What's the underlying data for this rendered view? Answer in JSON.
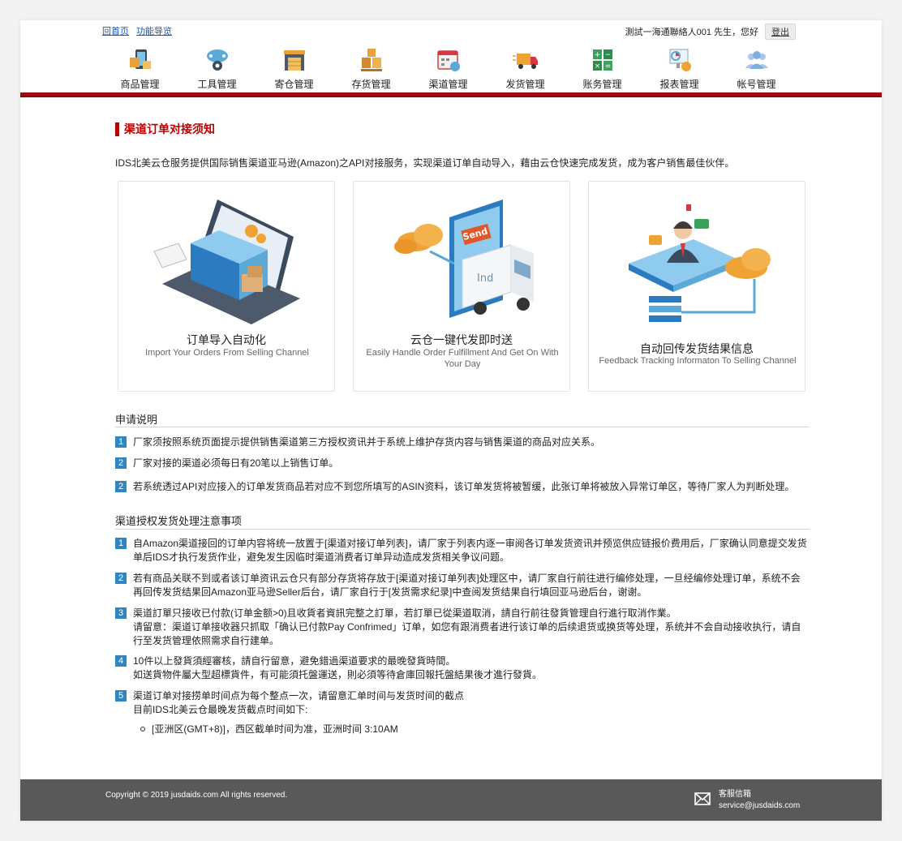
{
  "header": {
    "links": [
      "回首页",
      "功能导览"
    ],
    "greeting": "測試一海通聯絡人001 先生，您好",
    "logout": "登出"
  },
  "nav": [
    {
      "label": "商品管理",
      "icon": "product-icon"
    },
    {
      "label": "工具管理",
      "icon": "tools-icon"
    },
    {
      "label": "寄仓管理",
      "icon": "warehouse-icon"
    },
    {
      "label": "存货管理",
      "icon": "inventory-icon"
    },
    {
      "label": "渠道管理",
      "icon": "channel-icon"
    },
    {
      "label": "发货管理",
      "icon": "shipping-icon"
    },
    {
      "label": "账务管理",
      "icon": "accounting-icon"
    },
    {
      "label": "报表管理",
      "icon": "report-icon"
    },
    {
      "label": "帐号管理",
      "icon": "account-icon"
    }
  ],
  "page": {
    "title": "渠道订单对接须知",
    "intro": "IDS北美云仓服务提供国际销售渠道亚马逊(Amazon)之API对接服务，实现渠道订单自动导入，藉由云仓快速完成发货，成为客户销售最佳伙伴。"
  },
  "cards": [
    {
      "title": "订单导入自动化",
      "subtitle": "Import Your Orders From Selling Channel"
    },
    {
      "title": "云仓一键代发即时送",
      "subtitle": "Easily Handle Order Fulfillment And Get On With Your Day",
      "badge_text": "Send",
      "truck_text": "Ind"
    },
    {
      "title": "自动回传发货结果信息",
      "subtitle": "Feedback Tracking Informaton To Selling Channel"
    }
  ],
  "application": {
    "heading": "申请说明",
    "items": [
      {
        "num": "1",
        "text": "厂家须按照系统页面提示提供销售渠道第三方授权资讯并于系统上维护存货内容与销售渠道的商品对应关系。"
      },
      {
        "num": "2",
        "text": "厂家对接的渠道必须每日有20笔以上销售订单。"
      },
      {
        "num": "2",
        "text": "若系统透过API对应接入的订单发货商品若对应不到您所填写的ASIN资料，该订单发货将被暂缓，此张订单将被放入异常订单区，等待厂家人为判断处理。"
      }
    ]
  },
  "notes": {
    "heading": "渠道授权发货处理注意事项",
    "items": [
      {
        "num": "1",
        "text": "自Amazon渠道接回的订单内容将统一放置于[渠道对接订单列表]，请厂家于列表内逐一审阅各订单发货资讯并预览供应链报价费用后，厂家确认同意提交发货单后IDS才执行发货作业，避免发生因临时渠道消费者订单异动造成发货相关争议问题。"
      },
      {
        "num": "2",
        "text": "若有商品关联不到或者该订单资讯云仓只有部分存货将存放于[渠道对接订单列表]处理区中，请厂家自行前往进行编修处理，一旦经编修处理订单，系统不会再回传发货结果回Amazon亚马逊Seller后台，请厂家自行于[发货需求纪录]中查阅发货结果自行填回亚马逊后台，谢谢。"
      },
      {
        "num": "3",
        "text": "渠道訂單只接收已付款(订单金额>0)且收貨者資訊完整之訂單，若訂單已從渠道取消，請自行前往發貨管理自行進行取消作業。",
        "text2": "请留意：渠道订单接收器只抓取「确认已付款Pay Confrimed」订单，如您有跟消费者进行该订单的后续退货或换货等处理，系统并不会自动接收执行，请自行至发货管理依照需求自行建单。"
      },
      {
        "num": "4",
        "text": "10件以上發貨須經審核，請自行留意，避免錯過渠道要求的最晚發貨時間。",
        "text2": "如送貨物件屬大型超標貨件，有可能須托盤運送，則必須等待倉庫回報托盤結果後才進行發貨。"
      },
      {
        "num": "5",
        "text": "渠道订单对接捞单时间点为每个整点一次，请留意汇单时间与发货时间的截点",
        "text2": "目前IDS北美云仓最晚发货截点时间如下:"
      }
    ],
    "bullet": "[亚洲区(GMT+8)]，西区截单时间为准，亚洲时间 3:10AM"
  },
  "footer": {
    "copyright": "Copyright © 2019 jusdaids.com All rights reserved.",
    "service_label": "客服信箱",
    "service_email": "service@jusdaids.com"
  },
  "colors": {
    "accent": "#9d0a0e",
    "title": "#bb0000",
    "badge": "#2e87c4",
    "footer": "#595959"
  }
}
